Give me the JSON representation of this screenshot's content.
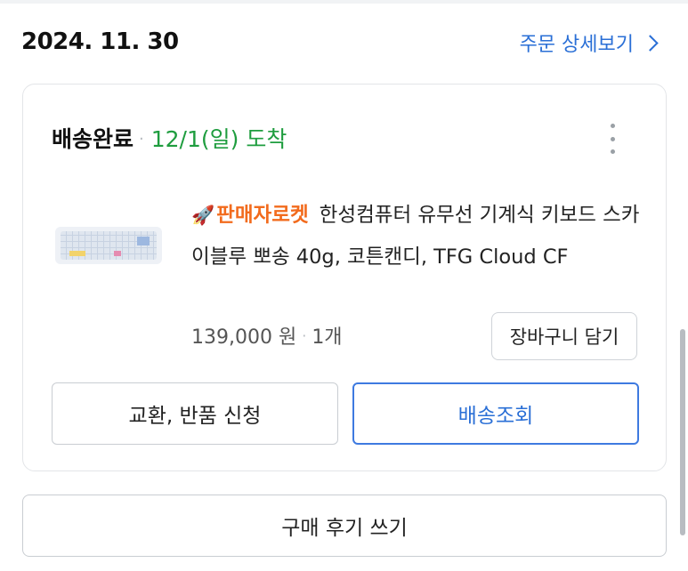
{
  "order": {
    "date": "2024. 11. 30",
    "detail_link": "주문 상세보기"
  },
  "shipment": {
    "status": "배송완료",
    "separator": "·",
    "arrival": "12/1(일) 도착"
  },
  "product": {
    "badge": "판매자로켓",
    "badge_icon": "rocket-icon",
    "name": "한성컴퓨터 유무선 기계식 키보드 스카이블루 뽀송 40g, 코튼캔디, TFG Cloud CF",
    "price": "139,000 원",
    "separator": "·",
    "quantity": "1개"
  },
  "buttons": {
    "add_to_cart": "장바구니 담기",
    "exchange_return": "교환, 반품 신청",
    "track_delivery": "배송조회",
    "write_review": "구매 후기 쓰기"
  },
  "colors": {
    "accent_blue": "#2a6fd6",
    "status_green": "#1f9d3f",
    "badge_orange": "#f26b1d"
  }
}
